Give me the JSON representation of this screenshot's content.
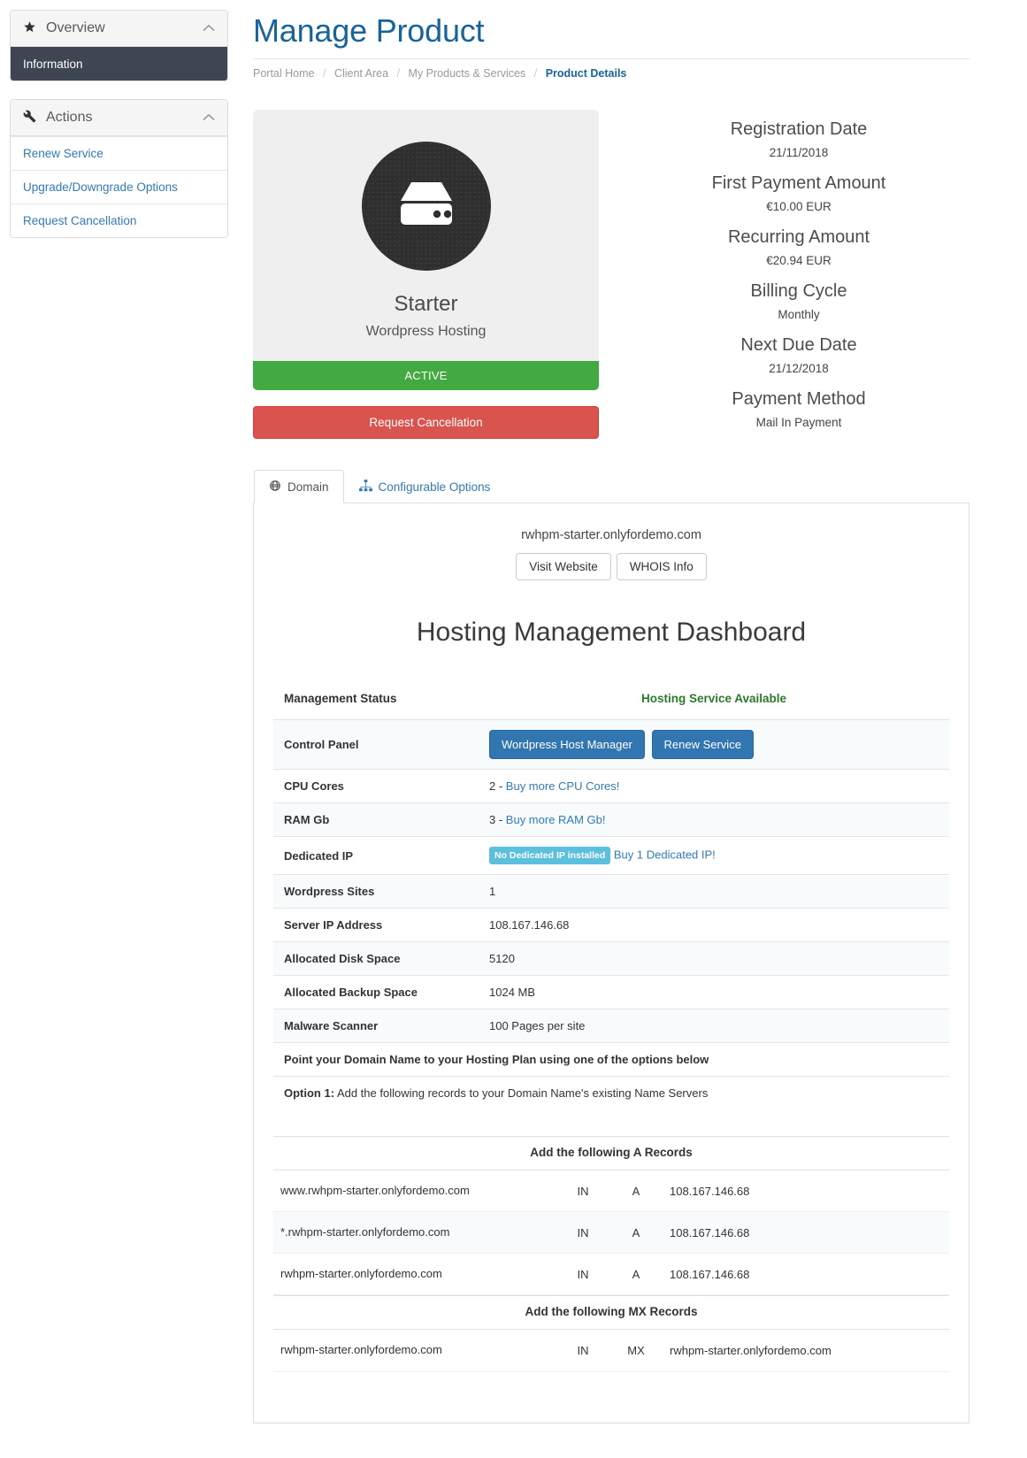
{
  "sidebar": {
    "overview": {
      "title": "Overview",
      "icon": "star-icon",
      "collapse_icon": "chevron-up-icon",
      "items": [
        {
          "label": "Information",
          "active": true
        }
      ]
    },
    "actions": {
      "title": "Actions",
      "icon": "wrench-icon",
      "collapse_icon": "chevron-up-icon",
      "items": [
        {
          "label": "Renew Service"
        },
        {
          "label": "Upgrade/Downgrade Options"
        },
        {
          "label": "Request Cancellation"
        }
      ]
    }
  },
  "header": {
    "title": "Manage Product",
    "breadcrumb": [
      "Portal Home",
      "Client Area",
      "My Products & Services",
      "Product Details"
    ]
  },
  "product": {
    "icon": "server-icon",
    "name": "Starter",
    "group": "Wordpress Hosting",
    "status": "ACTIVE",
    "status_color": "#43a942",
    "cancel_button": "Request Cancellation",
    "cancel_color": "#d9534f"
  },
  "details": [
    {
      "label": "Registration Date",
      "value": "21/11/2018"
    },
    {
      "label": "First Payment Amount",
      "value": "€10.00 EUR"
    },
    {
      "label": "Recurring Amount",
      "value": "€20.94 EUR"
    },
    {
      "label": "Billing Cycle",
      "value": "Monthly"
    },
    {
      "label": "Next Due Date",
      "value": "21/12/2018"
    },
    {
      "label": "Payment Method",
      "value": "Mail In Payment"
    }
  ],
  "tabs": [
    {
      "label": "Domain",
      "icon": "globe-icon",
      "active": true
    },
    {
      "label": "Configurable Options",
      "icon": "sitemap-icon",
      "active": false
    }
  ],
  "domain_panel": {
    "domain": "rwhpm-starter.onlyfordemo.com",
    "visit_button": "Visit Website",
    "whois_button": "WHOIS Info",
    "dashboard_title": "Hosting Management Dashboard",
    "table_headers": {
      "status": "Management Status",
      "available": "Hosting Service Available",
      "available_color": "#2d7a2d"
    },
    "rows": [
      {
        "key": "Control Panel",
        "type": "buttons",
        "buttons": [
          "Wordpress Host Manager",
          "Renew Service"
        ]
      },
      {
        "key": "CPU Cores",
        "type": "value_link",
        "value": "2 - ",
        "link": "Buy more CPU Cores!"
      },
      {
        "key": "RAM Gb",
        "type": "value_link",
        "value": "3 - ",
        "link": "Buy more RAM Gb!"
      },
      {
        "key": "Dedicated IP",
        "type": "badge_link",
        "badge": "No Dedicated IP installed",
        "badge_color": "#5bc0de",
        "link": "Buy 1 Dedicated IP!"
      },
      {
        "key": "Wordpress Sites",
        "type": "text",
        "value": "1"
      },
      {
        "key": "Server IP Address",
        "type": "text",
        "value": "108.167.146.68"
      },
      {
        "key": "Allocated Disk Space",
        "type": "text",
        "value": "5120"
      },
      {
        "key": "Allocated Backup Space",
        "type": "text",
        "value": "1024 MB"
      },
      {
        "key": "Malware Scanner",
        "type": "text",
        "value": "100 Pages per site"
      }
    ],
    "point_domain_note": "Point your Domain Name to your Hosting Plan using one of the options below",
    "option1_strong": "Option 1:",
    "option1_text": " Add the following records to your Domain Name's existing Name Servers",
    "a_records": {
      "title": "Add the following A Records",
      "rows": [
        {
          "host": "www.rwhpm-starter.onlyfordemo.com",
          "class": "IN",
          "type": "A",
          "target": "108.167.146.68"
        },
        {
          "host": "*.rwhpm-starter.onlyfordemo.com",
          "class": "IN",
          "type": "A",
          "target": "108.167.146.68"
        },
        {
          "host": "rwhpm-starter.onlyfordemo.com",
          "class": "IN",
          "type": "A",
          "target": "108.167.146.68"
        }
      ]
    },
    "mx_records": {
      "title": "Add the following MX Records",
      "rows": [
        {
          "host": "rwhpm-starter.onlyfordemo.com",
          "class": "IN",
          "type": "MX",
          "target": "rwhpm-starter.onlyfordemo.com"
        }
      ]
    }
  }
}
